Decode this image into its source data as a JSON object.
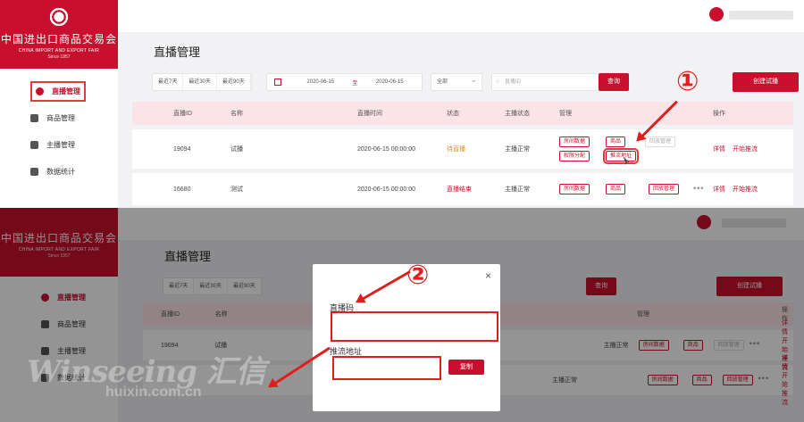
{
  "brand": {
    "name_cn": "中国进出口商品交易会",
    "name_en": "CHINA IMPORT AND EXPORT FAIR",
    "since": "Since 1957"
  },
  "nav": [
    {
      "label": "直播管理",
      "icon": "live-icon",
      "active": true
    },
    {
      "label": "商品管理",
      "icon": "product-icon",
      "active": false
    },
    {
      "label": "主播管理",
      "icon": "anchor-icon",
      "active": false
    },
    {
      "label": "数据统计",
      "icon": "chart-icon",
      "active": false
    }
  ],
  "page": {
    "title": "直播管理",
    "quick_filters": [
      "最近7天",
      "最近30天",
      "最近90天"
    ],
    "date_from": "2020-06-15",
    "date_sep": "至",
    "date_to": "2020-06-15",
    "status_select": "全部",
    "search_placeholder": "直播ID",
    "query_button": "查询",
    "create_button": "创建试播"
  },
  "table": {
    "headers": {
      "id": "直播ID",
      "name": "名称",
      "time": "直播时间",
      "status": "状态",
      "live_status": "主播状态",
      "manage": "管理",
      "ops": "操作"
    },
    "rows": [
      {
        "id": "19094",
        "name": "试播",
        "time": "2020-06-15 00:00:00",
        "status": "待直播",
        "live_status": "主播正常",
        "buttons": [
          "房间数据",
          "商品",
          "权限分配",
          "推流地址",
          "回放管理"
        ],
        "ops": [
          "详情",
          "开始推流"
        ]
      },
      {
        "id": "16680",
        "name": "测试",
        "time": "2020-06-15 00:00:00",
        "status": "直播结束",
        "live_status": "主播正常",
        "buttons": [
          "房间数据",
          "商品",
          "回放管理"
        ],
        "more": "•••",
        "ops": [
          "详情",
          "开始推流"
        ]
      }
    ]
  },
  "bottom_table": {
    "rows": [
      {
        "id": "19094",
        "name": "试播",
        "live_status": "主播正常",
        "buttons": [
          "房间数据",
          "商品",
          "回放管理"
        ],
        "more": "•••",
        "ops": [
          "详情",
          "开始推流"
        ]
      },
      {
        "live_status": "主播正常",
        "buttons": [
          "房间数据",
          "商品",
          "回放管理"
        ],
        "more": "•••",
        "ops": [
          "详情",
          "开始推流"
        ]
      }
    ]
  },
  "dialog": {
    "close": "×",
    "field1_label": "直播码",
    "field2_label": "推流地址",
    "copy_button": "复制"
  },
  "annotations": {
    "marker1": "①",
    "marker2": "②"
  },
  "watermark": {
    "logo": "Winseeing 汇信",
    "url": "huixin.com.cn"
  },
  "colors": {
    "brand": "#c8102e",
    "annotation": "#e01e1e",
    "header_bg": "#fbe4e7"
  }
}
